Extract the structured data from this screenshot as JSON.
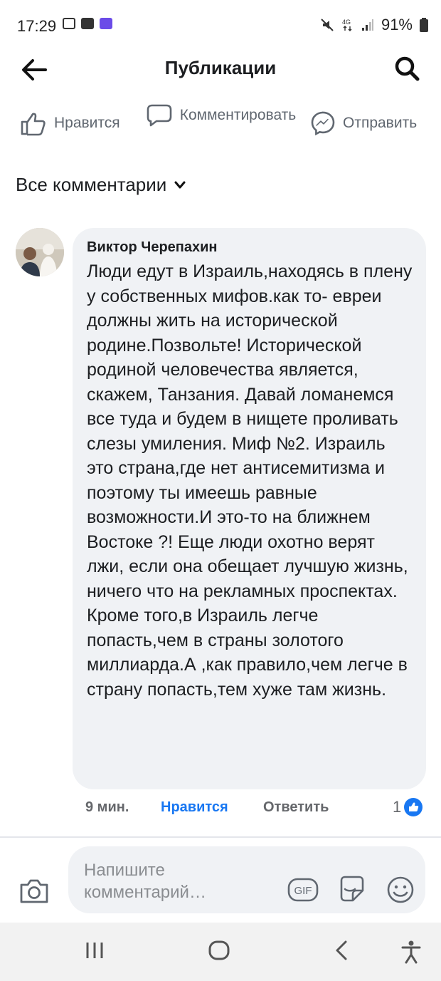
{
  "status_bar": {
    "time": "17:29",
    "battery": "91%",
    "icons": [
      "sim-icon",
      "app-icon",
      "messenger-app-icon",
      "mute-icon",
      "4g-icon",
      "signal-icon",
      "battery-icon"
    ]
  },
  "app_bar": {
    "title": "Публикации",
    "back_icon": "back-arrow-icon",
    "search_icon": "search-icon"
  },
  "actions": {
    "like_label": "Нравится",
    "comment_label": "Комментировать",
    "send_label": "Отправить"
  },
  "filter": {
    "label": "Все комментарии"
  },
  "comment": {
    "author": "Виктор Черепахин",
    "text": "Люди едут в Израиль,находясь в плену у собственных мифов.как то- евреи должны жить на исторической родине.Позвольте! Исторической родиной человечества является, скажем, Танзания. Давай ломанемся все туда и будем в нищете проливать слезы умиления. Миф №2. Израиль это страна,где нет антисемитизма и поэтому ты имеешь равные возможности.И это-то на ближнем Востоке ?! Еще люди охотно верят лжи, если она обещает лучшую жизнь, ничего что на рекламных проспектах. Кроме того,в Израиль легче попасть,чем в страны золотого миллиарда.А ,как правило,чем легче в страну попасть,тем хуже там жизнь.",
    "time": "9 мин.",
    "like_label": "Нравится",
    "reply_label": "Ответить",
    "like_count": "1"
  },
  "composer": {
    "placeholder": "Напишите комментарий…",
    "gif_label": "GIF"
  },
  "colors": {
    "accent": "#1877f2",
    "bubble": "#f0f2f5",
    "secondary_text": "#65676b"
  }
}
